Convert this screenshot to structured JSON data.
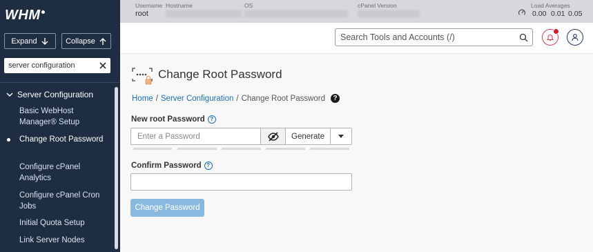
{
  "sidebar": {
    "logo": "WHM",
    "expand_label": "Expand",
    "collapse_label": "Collapse",
    "search_value": "server configuration",
    "section_title": "Server Configuration",
    "items": [
      {
        "label": "Basic WebHost Manager® Setup",
        "active": false
      },
      {
        "label": "Change Root Password",
        "active": true
      },
      {
        "label": "Configure cPanel Analytics",
        "active": false
      },
      {
        "label": "Configure cPanel Cron Jobs",
        "active": false
      },
      {
        "label": "Initial Quota Setup",
        "active": false
      },
      {
        "label": "Link Server Nodes",
        "active": false
      }
    ]
  },
  "status": {
    "username_label": "Username",
    "username": "root",
    "hostname_label": "Hostname",
    "os_label": "OS",
    "cpanel_version_label": "cPanel Version",
    "load_label": "Load Averages",
    "load_values": [
      "0.00",
      "0.01",
      "0.05"
    ]
  },
  "header": {
    "search_placeholder": "Search Tools and Accounts (/)"
  },
  "main": {
    "title": "Change Root Password",
    "breadcrumb": [
      "Home",
      "Server Configuration",
      "Change Root Password"
    ],
    "new_password_label": "New root Password",
    "password_placeholder": "Enter a Password",
    "generate_label": "Generate",
    "confirm_label": "Confirm Password",
    "confirm_value": "",
    "submit_label": "Change Password"
  },
  "icons": {
    "expand": "arrow-down-icon",
    "collapse": "arrow-up-icon",
    "clear": "close-icon",
    "section": "chevron-down-icon",
    "search": "search-icon",
    "notifications": "bell-icon",
    "account": "user-icon",
    "visibility": "eye-slash-icon",
    "options": "caret-down-icon",
    "help": "question-circle-icon"
  },
  "colors": {
    "sidebar_bg": "#1f2d43",
    "link": "#1a6fb5",
    "primary_button": "#8ab9df",
    "notification": "#d0202f"
  }
}
